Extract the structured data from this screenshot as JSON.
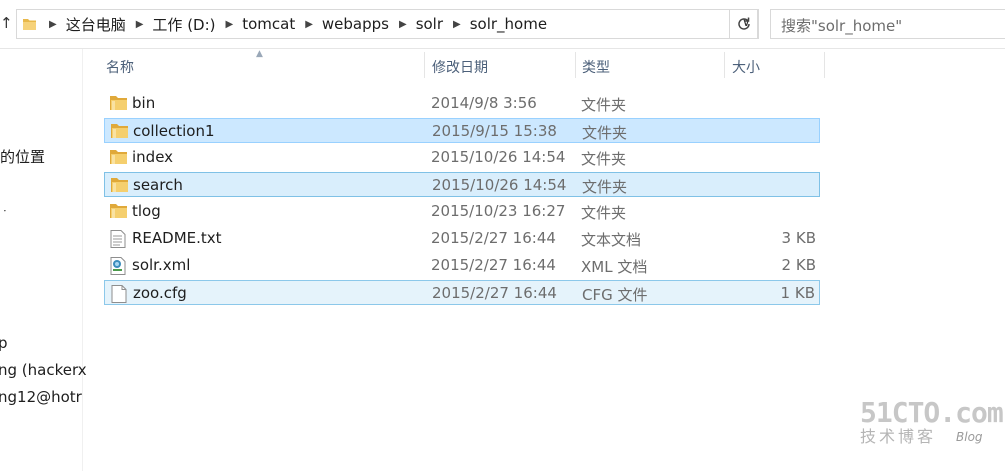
{
  "address_bar": {
    "breadcrumbs": [
      "这台电脑",
      "工作 (D:)",
      "tomcat",
      "webapps",
      "solr",
      "solr_home"
    ]
  },
  "search": {
    "placeholder": "搜索\"solr_home\""
  },
  "nav_pane": {
    "items": [
      "的位置",
      "ᆞ",
      "p",
      "ng (hackerx",
      "ng12@hotr"
    ]
  },
  "columns": {
    "name": "名称",
    "date": "修改日期",
    "type": "类型",
    "size": "大小"
  },
  "files": [
    {
      "name": "bin",
      "date": "2014/9/8 3:56",
      "type": "文件夹",
      "size": "",
      "icon": "folder-icon",
      "state": "normal"
    },
    {
      "name": "collection1",
      "date": "2015/9/15 15:38",
      "type": "文件夹",
      "size": "",
      "icon": "folder-icon",
      "state": "selected"
    },
    {
      "name": "index",
      "date": "2015/10/26 14:54",
      "type": "文件夹",
      "size": "",
      "icon": "folder-icon",
      "state": "normal"
    },
    {
      "name": "search",
      "date": "2015/10/26 14:54",
      "type": "文件夹",
      "size": "",
      "icon": "folder-icon",
      "state": "selected-focus"
    },
    {
      "name": "tlog",
      "date": "2015/10/23 16:27",
      "type": "文件夹",
      "size": "",
      "icon": "folder-icon",
      "state": "normal"
    },
    {
      "name": "README.txt",
      "date": "2015/2/27 16:44",
      "type": "文本文档",
      "size": "3 KB",
      "icon": "text-file-icon",
      "state": "normal"
    },
    {
      "name": "solr.xml",
      "date": "2015/2/27 16:44",
      "type": "XML 文档",
      "size": "2 KB",
      "icon": "xml-file-icon",
      "state": "normal"
    },
    {
      "name": "zoo.cfg",
      "date": "2015/2/27 16:44",
      "type": "CFG 文件",
      "size": "1 KB",
      "icon": "file-icon",
      "state": "hover"
    }
  ],
  "watermark": {
    "big": "51CTO.com",
    "small": "技术博客",
    "blog": "Blog"
  },
  "colors": {
    "selected_bg": "#cce8ff",
    "selected_border": "#99d1ff",
    "folder_yellow": "#e8b84a",
    "header_text": "#4c607a"
  }
}
